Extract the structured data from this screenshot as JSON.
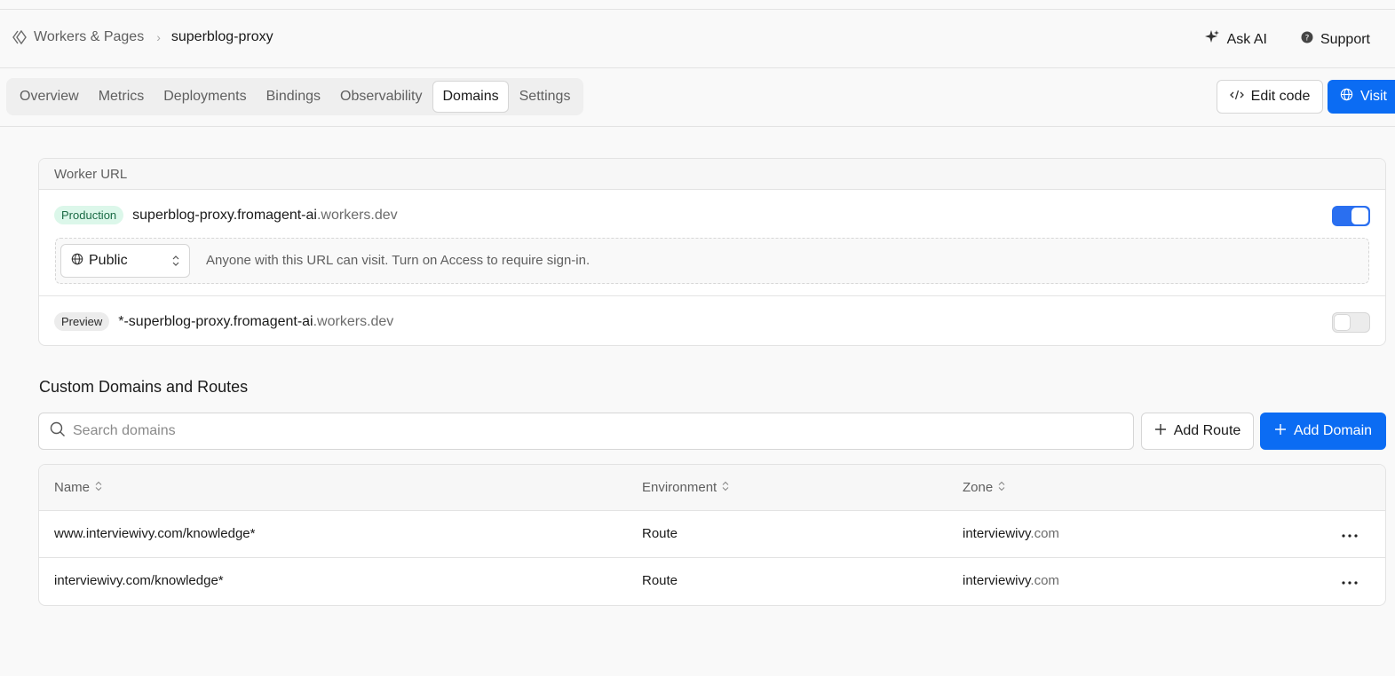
{
  "header": {
    "breadcrumb_root": "Workers & Pages",
    "breadcrumb_current": "superblog-proxy",
    "ask_ai": "Ask AI",
    "support": "Support"
  },
  "tabs": [
    "Overview",
    "Metrics",
    "Deployments",
    "Bindings",
    "Observability",
    "Domains",
    "Settings"
  ],
  "active_tab": "Domains",
  "actions": {
    "edit_code": "Edit code",
    "visit": "Visit"
  },
  "worker_url": {
    "title": "Worker URL",
    "production": {
      "badge": "Production",
      "url_main": "superblog-proxy.fromagent-ai",
      "url_suffix": ".workers.dev",
      "enabled": true
    },
    "access": {
      "select_value": "Public",
      "description": "Anyone with this URL can visit. Turn on Access to require sign-in."
    },
    "preview": {
      "badge": "Preview",
      "url_main": "*-superblog-proxy.fromagent-ai",
      "url_suffix": ".workers.dev",
      "enabled": false
    }
  },
  "custom_domains": {
    "title": "Custom Domains and Routes",
    "search_placeholder": "Search domains",
    "add_route": "Add Route",
    "add_domain": "Add Domain",
    "columns": [
      "Name",
      "Environment",
      "Zone"
    ],
    "rows": [
      {
        "name": "www.interviewivy.com/knowledge*",
        "environment": "Route",
        "zone_main": "interviewivy",
        "zone_tld": ".com"
      },
      {
        "name": "interviewivy.com/knowledge*",
        "environment": "Route",
        "zone_main": "interviewivy",
        "zone_tld": ".com"
      }
    ]
  },
  "colors": {
    "accent": "#0b6cf3",
    "toggle_on": "#2a6ff0",
    "production_badge_bg": "#dcf7ea"
  }
}
